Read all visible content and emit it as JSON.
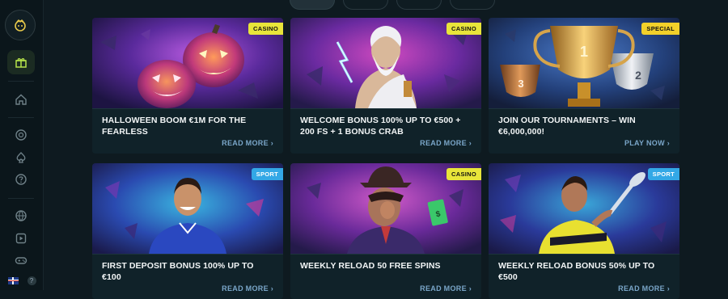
{
  "sidebar": {
    "items": [
      {
        "name": "promotions-gift-icon",
        "active": true
      },
      {
        "name": "home-icon"
      },
      {
        "name": "casino-chip-icon"
      },
      {
        "name": "spade-icon"
      },
      {
        "name": "help-circle-icon"
      },
      {
        "name": "sports-ball-icon"
      },
      {
        "name": "play-video-icon"
      },
      {
        "name": "gamepad-icon"
      }
    ],
    "language": "EN",
    "help_label": "?"
  },
  "promotions": [
    {
      "title": "HALLOWEEN BOOM €1M FOR THE FEARLESS",
      "badge": "CASINO",
      "cta": "READ MORE",
      "art": "pumpkins"
    },
    {
      "title": "WELCOME BONUS 100% UP TO €500 + 200 FS + 1 BONUS CRAB",
      "badge": "CASINO",
      "cta": "READ MORE",
      "art": "zeus"
    },
    {
      "title": "JOIN OUR TOURNAMENTS – WIN €6,000,000!",
      "badge": "SPECIAL",
      "cta": "PLAY NOW",
      "art": "trophies"
    },
    {
      "title": "FIRST DEPOSIT BONUS 100% UP TO €100",
      "badge": "SPORT",
      "cta": "READ MORE",
      "art": "footballer"
    },
    {
      "title": "WEEKLY RELOAD 50 FREE SPINS",
      "badge": "CASINO",
      "cta": "READ MORE",
      "art": "gangster"
    },
    {
      "title": "WEEKLY RELOAD BONUS 50% UP TO €500",
      "badge": "SPORT",
      "cta": "READ MORE",
      "art": "tennis"
    }
  ],
  "colors": {
    "casino_badge": "#e8e53a",
    "special_badge": "#f2d02a",
    "sport_badge": "#33a8e6",
    "cta": "#7aa6c9"
  }
}
